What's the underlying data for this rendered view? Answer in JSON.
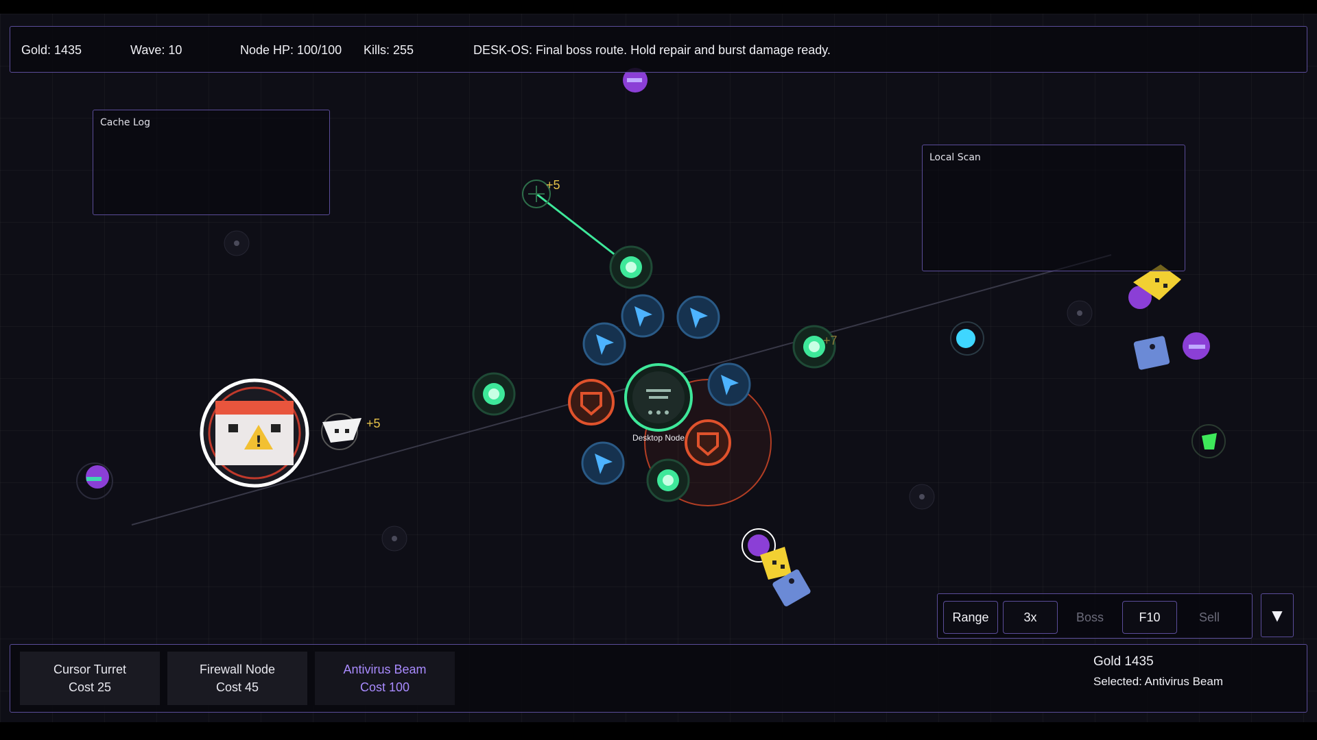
{
  "hud": {
    "gold": "Gold: 1435",
    "wave": "Wave: 10",
    "node_hp": "Node HP: 100/100",
    "kills": "Kills: 255",
    "message": "DESK-OS: Final boss route. Hold repair and burst damage ready."
  },
  "zones": {
    "cache_log": "Cache Log",
    "local_scan": "Local Scan"
  },
  "map": {
    "core_label": "Desktop Node",
    "floaters": [
      "+5",
      "+7",
      "+5"
    ]
  },
  "controls": {
    "range": "Range",
    "speed": "3x",
    "boss": "Boss",
    "f10": "F10",
    "sell": "Sell",
    "collapse_glyph": "▼"
  },
  "build": {
    "towers": [
      {
        "name": "Cursor Turret",
        "cost": "Cost 25"
      },
      {
        "name": "Firewall Node",
        "cost": "Cost 45"
      },
      {
        "name": "Antivirus Beam",
        "cost": "Cost 100"
      }
    ],
    "gold": "Gold 1435",
    "selected": "Selected: Antivirus Beam"
  },
  "colors": {
    "accent_border": "#5b4d9a",
    "selected_text": "#a98bff",
    "beam_green": "#3ee89a",
    "firewall_orange": "#e0522c",
    "cursor_blue": "#2f8fe0",
    "enemy_purple": "#8b3fd6",
    "floater_gold": "#e6c24a"
  },
  "icons": {
    "cursor_turret": "cursor-arrow-icon",
    "firewall_node": "shield-icon",
    "antivirus_beam": "green-orb-icon",
    "core": "document-icon",
    "boss": "warning-window-icon"
  }
}
